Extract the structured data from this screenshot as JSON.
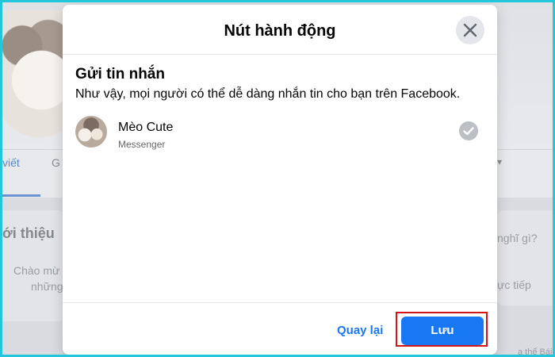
{
  "background": {
    "tab_active": "viết",
    "tab_other": "G",
    "intro_title": "ới thiệu",
    "intro_line1": "Chào mừ",
    "intro_line2": "những",
    "right_hint1": "nghĩ gì?",
    "right_hint2": "ực tiếp",
    "bottom_right": "a thể Bái"
  },
  "modal": {
    "title": "Nút hành động",
    "section_title": "Gửi tin nhắn",
    "section_desc": "Như vậy, mọi người có thể dễ dàng nhắn tin cho bạn trên Facebook.",
    "account": {
      "name": "Mèo Cute",
      "platform": "Messenger",
      "selected": true
    },
    "footer": {
      "back_label": "Quay lại",
      "save_label": "Lưu"
    }
  },
  "colors": {
    "accent": "#1877f2",
    "highlight": "#d4141b",
    "frame_border": "#23c7d9"
  },
  "icons": {
    "close": "close-icon",
    "check": "check-circle-icon",
    "caret": "caret-down-icon"
  }
}
